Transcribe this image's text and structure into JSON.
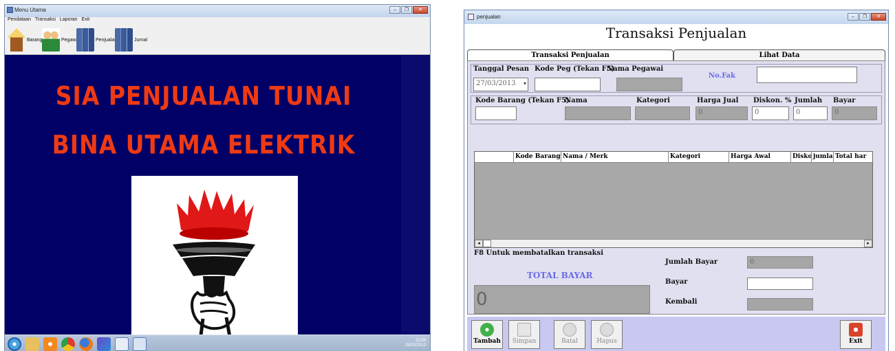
{
  "left_window": {
    "title": "Menu Utama",
    "menu": [
      "Pendataan",
      "Transaksi",
      "Laporan",
      "Exit"
    ],
    "toolbar": [
      {
        "label": "Barang",
        "icon": "house-icon"
      },
      {
        "label": "Pegawai",
        "icon": "people-icon"
      },
      {
        "label": "Penjualan",
        "icon": "books-icon"
      },
      {
        "label": "Jurnal",
        "icon": "books-icon"
      }
    ],
    "heading_1": "SIA PENJUALAN TUNAI",
    "heading_2": "BINA UTAMA ELEKTRIK",
    "logo": "torch-crown-logo",
    "taskbar": {
      "time": "21:04",
      "date": "25/02/2013"
    },
    "colors": {
      "background": "#000066",
      "heading": "#ee3a14"
    }
  },
  "right_window": {
    "title": "penjualan",
    "form_title": "Transaksi Penjualan",
    "tabs": [
      "Transaksi Penjualan",
      "Lihat Data"
    ],
    "header_fields": {
      "tanggal_label": "Tanggal Pesan",
      "tanggal_value": "27/03/2013",
      "kode_peg_label": "Kode Peg (Tekan F5)",
      "kode_peg_value": "",
      "nama_pegawai_label": "Nama Pegawai",
      "nama_pegawai_value": "",
      "no_fak_label": "No.Fak",
      "no_fak_value": ""
    },
    "item_fields": {
      "kode_barang_label": "Kode Barang (Tekan F5)",
      "nama_label": "Nama",
      "kategori_label": "Kategori",
      "harga_jual_label": "Harga Jual",
      "harga_jual_value": "0",
      "diskon_label": "Diskon. %",
      "diskon_value": "0",
      "jumlah_label": "Jumlah",
      "jumlah_value": "0",
      "bayar_label": "Bayar",
      "bayar_value": "0"
    },
    "grid_columns": [
      "",
      "Kode Barang",
      "Nama / Merk",
      "Kategori",
      "Harga Awal",
      "Diskon",
      "jumlah",
      "Total har"
    ],
    "f8_note": "F8 Untuk membatalkan transaksi",
    "total_bayar_label": "TOTAL BAYAR",
    "total_bayar_value": "0",
    "summary": {
      "jumlah_bayar_label": "Jumlah Bayar",
      "jumlah_bayar_value": "0",
      "bayar_label": "Bayar",
      "bayar_value": "",
      "kembali_label": "Kembali",
      "kembali_value": ""
    },
    "buttons": {
      "tambah": "Tambah",
      "simpan": "Simpan",
      "batal": "Batal",
      "hapus": "Hapus",
      "exit": "Exit"
    },
    "colors": {
      "panel": "#e0e0f0",
      "button_bar": "#c8c8f0",
      "accent_label": "#6a6ae6"
    }
  }
}
